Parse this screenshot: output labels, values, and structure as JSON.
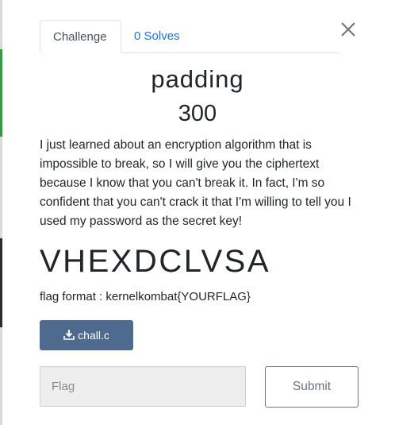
{
  "modal": {
    "tabs": [
      {
        "label": "Challenge",
        "active": true
      },
      {
        "label": "0 Solves",
        "active": false
      }
    ],
    "close_icon": "close-icon"
  },
  "challenge": {
    "name": "padding",
    "value": "300",
    "description": "I just learned about an encryption algorithm that is impossible to break, so I will give you the ciphertext because I know that you can't break it. In fact, I'm so confident that you can't crack it that I'm willing to tell you I used my password as the secret key!",
    "ciphertext": "VHEXDCLVSA",
    "flag_format": "flag format : kernelkombat{YOURFLAG}",
    "file": {
      "label": "chall.c",
      "icon": "download-icon"
    }
  },
  "submission": {
    "placeholder": "Flag",
    "value": "",
    "submit_label": "Submit"
  },
  "colors": {
    "tab_link": "#1a73e8",
    "download_button": "#4e6a8f",
    "input_background": "#eeeeee",
    "submit_border": "#6c757d"
  }
}
